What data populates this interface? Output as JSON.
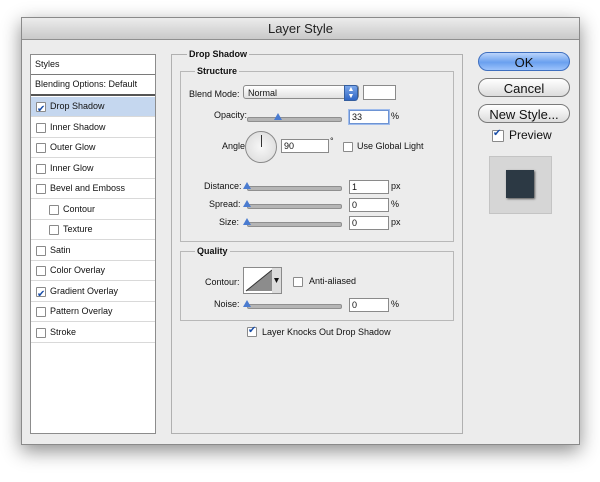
{
  "window": {
    "title": "Layer Style"
  },
  "styles_list": {
    "header": "Styles",
    "blending_options": "Blending Options: Default",
    "items": [
      {
        "label": "Drop Shadow",
        "checked": true,
        "selected": true,
        "indent": false
      },
      {
        "label": "Inner Shadow",
        "checked": false,
        "selected": false,
        "indent": false
      },
      {
        "label": "Outer Glow",
        "checked": false,
        "selected": false,
        "indent": false
      },
      {
        "label": "Inner Glow",
        "checked": false,
        "selected": false,
        "indent": false
      },
      {
        "label": "Bevel and Emboss",
        "checked": false,
        "selected": false,
        "indent": false
      },
      {
        "label": "Contour",
        "checked": false,
        "selected": false,
        "indent": true
      },
      {
        "label": "Texture",
        "checked": false,
        "selected": false,
        "indent": true
      },
      {
        "label": "Satin",
        "checked": false,
        "selected": false,
        "indent": false
      },
      {
        "label": "Color Overlay",
        "checked": false,
        "selected": false,
        "indent": false
      },
      {
        "label": "Gradient Overlay",
        "checked": true,
        "selected": false,
        "indent": false
      },
      {
        "label": "Pattern Overlay",
        "checked": false,
        "selected": false,
        "indent": false
      },
      {
        "label": "Stroke",
        "checked": false,
        "selected": false,
        "indent": false
      }
    ]
  },
  "drop_shadow": {
    "title": "Drop Shadow",
    "structure": {
      "title": "Structure",
      "blend_mode_label": "Blend Mode:",
      "blend_mode_value": "Normal",
      "shadow_color": "#ffffff",
      "opacity_label": "Opacity:",
      "opacity_value": "33",
      "opacity_fraction": 0.33,
      "percent": "%",
      "angle_label": "Angle:",
      "angle_value": "90",
      "degree": "°",
      "use_global_light": "Use Global Light",
      "use_global_light_checked": false,
      "distance_label": "Distance:",
      "distance_value": "1",
      "px": "px",
      "spread_label": "Spread:",
      "spread_value": "0",
      "size_label": "Size:",
      "size_value": "0"
    },
    "quality": {
      "title": "Quality",
      "contour_label": "Contour:",
      "anti_aliased": "Anti-aliased",
      "anti_aliased_checked": false,
      "noise_label": "Noise:",
      "noise_value": "0",
      "percent": "%"
    },
    "knockout_label": "Layer Knocks Out Drop Shadow",
    "knockout_checked": true
  },
  "buttons": {
    "ok": "OK",
    "cancel": "Cancel",
    "new_style": "New Style...",
    "preview": "Preview",
    "preview_checked": true
  },
  "colors": {
    "accent": "#6aa0ef",
    "selection": "#c5d7ef",
    "preview_swatch": "#2c3944"
  }
}
